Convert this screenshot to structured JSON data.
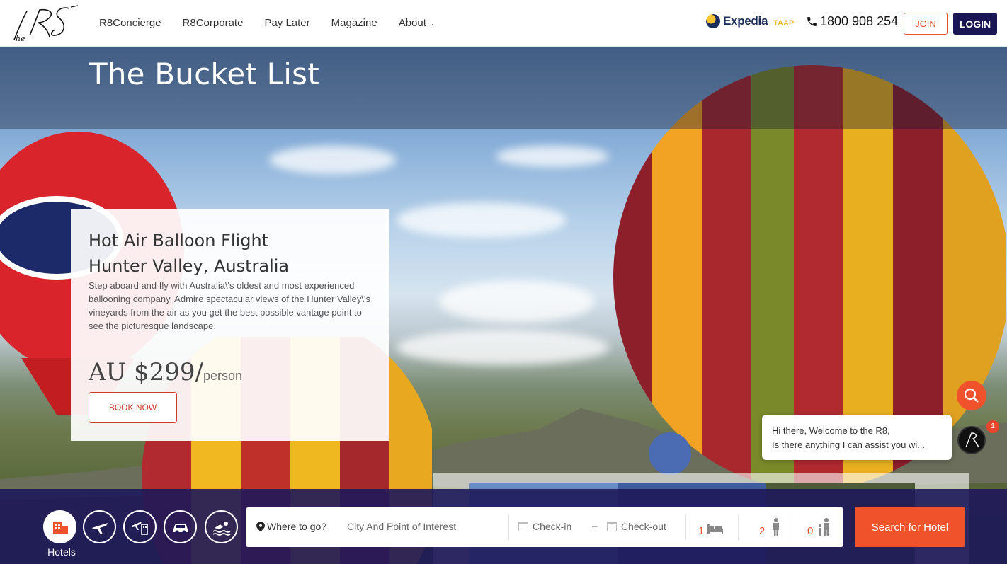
{
  "nav": {
    "logo_alt": "The R8",
    "menu": [
      {
        "label": "R8Concierge"
      },
      {
        "label": "R8Corporate"
      },
      {
        "label": "Pay Later"
      },
      {
        "label": "Magazine"
      },
      {
        "label": "About"
      }
    ],
    "partner_name": "Expedia",
    "partner_tag": "TAAP",
    "phone": "1800 908 254",
    "join_label": "JOIN",
    "login_label": "LOGIN"
  },
  "hero": {
    "title": "The Bucket List"
  },
  "card": {
    "title_line1": "Hot Air Balloon Flight",
    "title_line2": "Hunter Valley, Australia",
    "description": "Step aboard and fly with Australia\\'s oldest and most experienced ballooning company. Admire spectacular views of the Hunter Valley\\'s vineyards from the air as you get the best possible vantage point to see the picturesque landscape.",
    "price": "AU $299",
    "price_sep": "/",
    "price_unit": "person",
    "book_label": "BOOK NOW"
  },
  "chat": {
    "line1": "Hi there, Welcome to the R8,",
    "line2": "Is there anything I can assist you wi...",
    "badge": "1"
  },
  "search": {
    "categories": [
      {
        "name": "Hotels",
        "icon": "hotel-icon"
      },
      {
        "name": "Flights",
        "icon": "plane-icon"
      },
      {
        "name": "Flight + Hotel",
        "icon": "flight-hotel-icon"
      },
      {
        "name": "Cars",
        "icon": "car-icon"
      },
      {
        "name": "Activities",
        "icon": "swim-icon"
      }
    ],
    "active_label": "Hotels",
    "where_label": "Where to go?",
    "where_placeholder": "City And Point of Interest",
    "checkin": "Check-in",
    "dash": "–",
    "checkout": "Check-out",
    "rooms": "1",
    "adults": "2",
    "children": "0",
    "submit": "Search for Hotel"
  },
  "colors": {
    "brand_navy": "#1a1553",
    "accent_orange": "#f0532b",
    "book_red": "#c9392d"
  }
}
